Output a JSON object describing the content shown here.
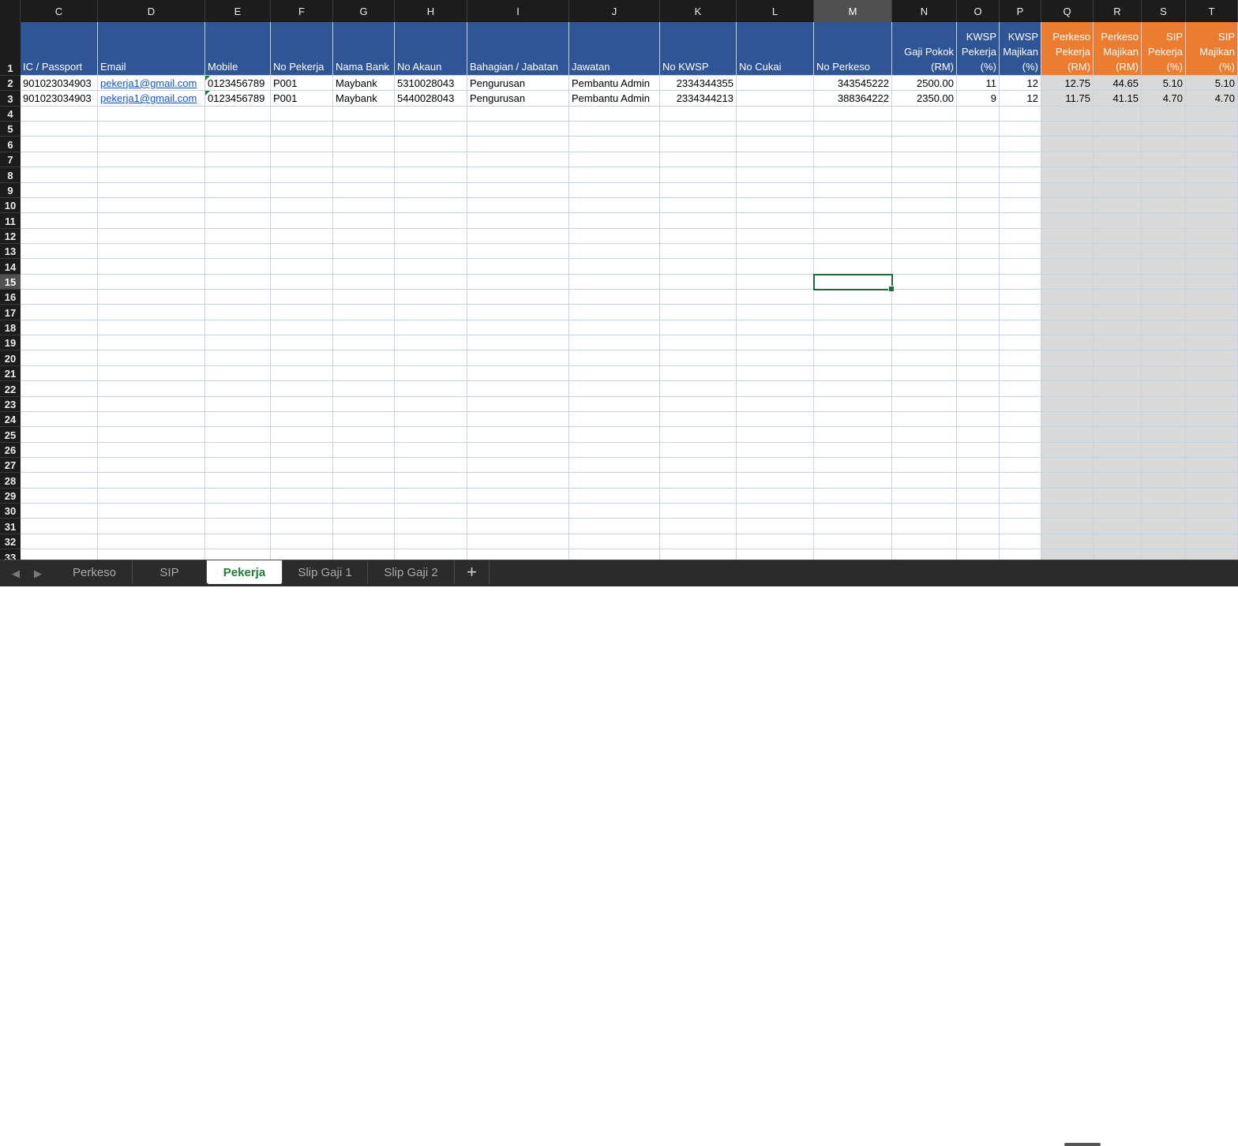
{
  "columns": [
    "C",
    "D",
    "E",
    "F",
    "G",
    "H",
    "I",
    "J",
    "K",
    "L",
    "M",
    "N",
    "O",
    "P",
    "Q",
    "R",
    "S",
    "T"
  ],
  "selected_column": "M",
  "selected_row": 15,
  "row_numbers": [
    "1",
    "2",
    "3",
    "4",
    "5",
    "6",
    "7",
    "8",
    "9",
    "10",
    "11",
    "12",
    "13",
    "14",
    "15",
    "16",
    "17",
    "18",
    "19",
    "20",
    "21",
    "22",
    "23",
    "24",
    "25",
    "26",
    "27",
    "28",
    "29",
    "30",
    "31",
    "32",
    "33"
  ],
  "headers": [
    "IC / Passport",
    "Email",
    "Mobile",
    "No Pekerja",
    "Nama Bank",
    "No Akaun",
    "Bahagian / Jabatan",
    "Jawatan",
    "No KWSP",
    "No Cukai",
    "No Perkeso",
    "Gaji Pokok\n(RM)",
    "KWSP\nPekerja\n(%)",
    "KWSP\nMajikan\n(%)",
    "Perkeso\nPekerja\n(RM)",
    "Perkeso\nMajikan\n(RM)",
    "SIP\nPekerja\n(%)",
    "SIP\nMajikan\n(%)"
  ],
  "rows": [
    [
      "901023034903",
      "pekerja1@gmail.com",
      "0123456789",
      "P001",
      "Maybank",
      "5310028043",
      "Pengurusan",
      "Pembantu Admin",
      "2334344355",
      "",
      "343545222",
      "2500.00",
      "11",
      "12",
      "12.75",
      "44.65",
      "5.10",
      "5.10"
    ],
    [
      "901023034903",
      "pekerja1@gmail.com",
      "0123456789",
      "P001",
      "Maybank",
      "5440028043",
      "Pengurusan",
      "Pembantu Admin",
      "2334344213",
      "",
      "388364222",
      "2350.00",
      "9",
      "12",
      "11.75",
      "41.15",
      "4.70",
      "4.70"
    ]
  ],
  "colors": {
    "header_blue": "#2f5597",
    "header_orange": "#ec7c30",
    "computed_grey": "#d9d9d9",
    "active_tab_text": "#1e7e34"
  },
  "sheet_tabs": [
    "Perkeso",
    "SIP",
    "Pekerja",
    "Slip Gaji 1",
    "Slip Gaji 2"
  ],
  "active_tab": "Pekerja",
  "icons": {
    "prev_sheet": "chevron-left-icon",
    "next_sheet": "chevron-right-icon",
    "add_sheet": "plus-icon"
  }
}
